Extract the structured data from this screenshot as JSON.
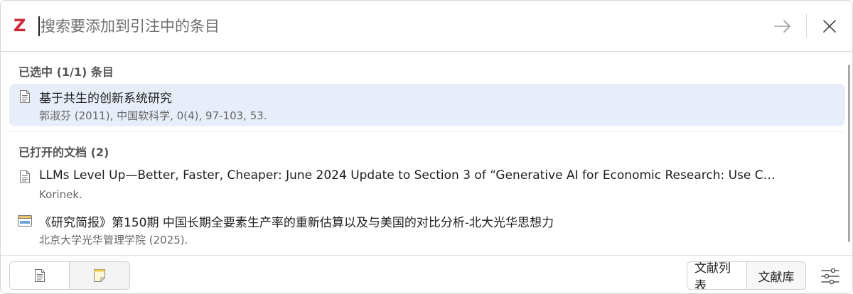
{
  "search": {
    "logo": "Z",
    "placeholder": "搜索要添加到引注中的条目"
  },
  "sections": [
    {
      "title": "已选中 (1/1) 条目",
      "items": [
        {
          "title": "基于共生的创新系统研究",
          "subtitle": "郭淑芬 (2011), 中国软科学, 0(4), 97-103, 53.",
          "icon": "document-icon",
          "selected": true
        }
      ]
    },
    {
      "title": "已打开的文档 (2)",
      "items": [
        {
          "title": "LLMs Level Up—Better, Faster, Cheaper: June 2024 Update to Section 3 of “Generative AI for Economic Research: Use C…",
          "subtitle": "Korinek.",
          "icon": "document-icon",
          "selected": false
        },
        {
          "title": "《研究简报》第150期 中国长期全要素生产率的重新估算以及与美国的对比分析-北大光华思想力",
          "subtitle": "北京大学光华管理学院 (2025).",
          "icon": "webpage-icon",
          "selected": false
        }
      ]
    }
  ],
  "bottom": {
    "view_buttons": [
      "document-view-icon",
      "note-view-icon"
    ],
    "bibliography_label": "文献列表",
    "library_label": "文献库",
    "settings_icon": "settings-sliders-icon"
  },
  "colors": {
    "brand": "#cc2936",
    "selected_bg": "#e8eef9"
  }
}
